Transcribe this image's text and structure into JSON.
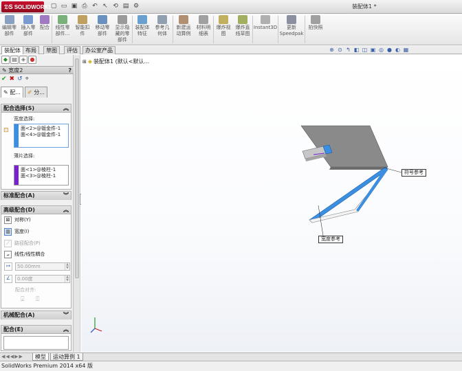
{
  "app": {
    "logo_text": "SOLIDWORKS",
    "document_title": "装配体1 *",
    "status_bar": "SolidWorks Premium 2014 x64 版"
  },
  "ribbon": [
    {
      "label": "编辑零\n部件",
      "icon": "edit-component-icon"
    },
    {
      "label": "插入零\n部件",
      "icon": "insert-component-icon"
    },
    {
      "label": "配合",
      "icon": "mate-icon"
    },
    {
      "label": "线性零\n部件...",
      "icon": "linear-pattern-icon"
    },
    {
      "label": "智能扣\n件",
      "icon": "smart-fastener-icon"
    },
    {
      "label": "移动零\n部件",
      "icon": "move-component-icon"
    },
    {
      "label": "显示隐\n藏的零\n部件",
      "icon": "show-hidden-icon"
    },
    {
      "label": "装配体\n特征",
      "icon": "assembly-feature-icon"
    },
    {
      "label": "参考几\n何体",
      "icon": "reference-geometry-icon"
    },
    {
      "label": "新建运\n动算例",
      "icon": "new-motion-study-icon"
    },
    {
      "label": "材料明\n细表",
      "icon": "bom-icon"
    },
    {
      "label": "爆炸视\n图",
      "icon": "exploded-view-icon"
    },
    {
      "label": "爆炸直\n线草图",
      "icon": "explode-line-sketch-icon"
    },
    {
      "label": "Instant3D",
      "icon": "instant3d-icon"
    },
    {
      "label": "更新\nSpeedpak",
      "icon": "speedpak-icon"
    },
    {
      "label": "拍快照",
      "icon": "snapshot-icon"
    }
  ],
  "command_tabs": [
    "装配体",
    "布局",
    "草图",
    "评估",
    "办公室产品"
  ],
  "feature_tree": {
    "root_label": "装配体1 (默认<默认..."
  },
  "property_manager": {
    "title": "宽度2",
    "tabs": [
      "配...",
      "分..."
    ],
    "mate_selections": {
      "header": "配合选择(S)",
      "width_label": "宽度选择:",
      "width_items": [
        "面<2>@钣金件-1",
        "面<4>@钣金件-1"
      ],
      "tab_label": "薄片选择:",
      "tab_items": [
        "面<1>@棱柱-1",
        "面<3>@棱柱-1"
      ]
    },
    "standard_mates": {
      "header": "标准配合(A)"
    },
    "advanced_mates": {
      "header": "高级配合(D)",
      "items": [
        {
          "label": "对称(Y)",
          "icon": "symmetric-icon",
          "enabled": true
        },
        {
          "label": "宽度(I)",
          "icon": "width-icon",
          "enabled": true
        },
        {
          "label": "路径配合(P)",
          "icon": "path-mate-icon",
          "enabled": false
        },
        {
          "label": "线性/线性耦合",
          "icon": "linear-coupler-icon",
          "enabled": true
        }
      ],
      "distance_value": "50.00mm",
      "angle_value": "0.00度",
      "align_label": "配合对齐:"
    },
    "mechanical_mates": {
      "header": "机械配合(A)"
    },
    "mates": {
      "header": "配合(E)"
    }
  },
  "graphics": {
    "callout_tab": "符号参考",
    "callout_width": "宽度参考"
  },
  "bottom_tabs": [
    "模型",
    "运动算例 1"
  ],
  "colors": {
    "selection_blue": "#3b8fe0",
    "selection_purple": "#7a1fd1",
    "sheet_top": "#8a8a8a",
    "logo_red": "#c8102e"
  }
}
